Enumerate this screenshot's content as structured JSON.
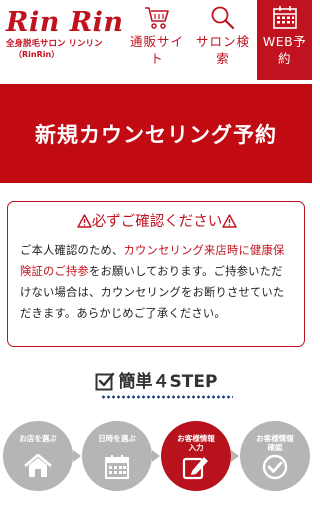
{
  "header": {
    "logo_text": "Rin Rin",
    "logo_sub": "全身脱毛サロン リンリン",
    "logo_sub2": "（RinRin）",
    "nav": [
      {
        "label_line1": "通販サイ",
        "label_line2": "ト",
        "icon": "cart-icon"
      },
      {
        "label_line1": "サロン検",
        "label_line2": "索",
        "icon": "search-icon"
      },
      {
        "label_line1": "WEB予",
        "label_line2": "約",
        "icon": "calendar-icon"
      }
    ]
  },
  "banner": {
    "title": "新規カウンセリング予約"
  },
  "notice": {
    "title": "必ずご確認ください",
    "body_1": "ご本人確認のため、",
    "body_highlight": "カウンセリング来店時に健康保険証のご持参",
    "body_2": "をお願いしております。ご持参いただけない場合は、カウンセリングをお断りさせていただきます。あらかじめご了承ください。"
  },
  "steps": {
    "title": "簡単４STEP",
    "items": [
      {
        "label": "お店を選ぶ",
        "icon": "house-icon",
        "active": false
      },
      {
        "label": "日時を選ぶ",
        "icon": "calendar-icon",
        "active": false
      },
      {
        "label_line1": "お客様情報",
        "label_line2": "入力",
        "icon": "pencil-icon",
        "active": true
      },
      {
        "label_line1": "お客様情報",
        "label_line2": "確認",
        "icon": "check-circle-icon",
        "active": false
      }
    ]
  },
  "colors": {
    "brand_red": "#c1121f",
    "banner_red": "#c10a12",
    "step_gray": "#b5b5b5",
    "dots_navy": "#1e3f7a"
  }
}
